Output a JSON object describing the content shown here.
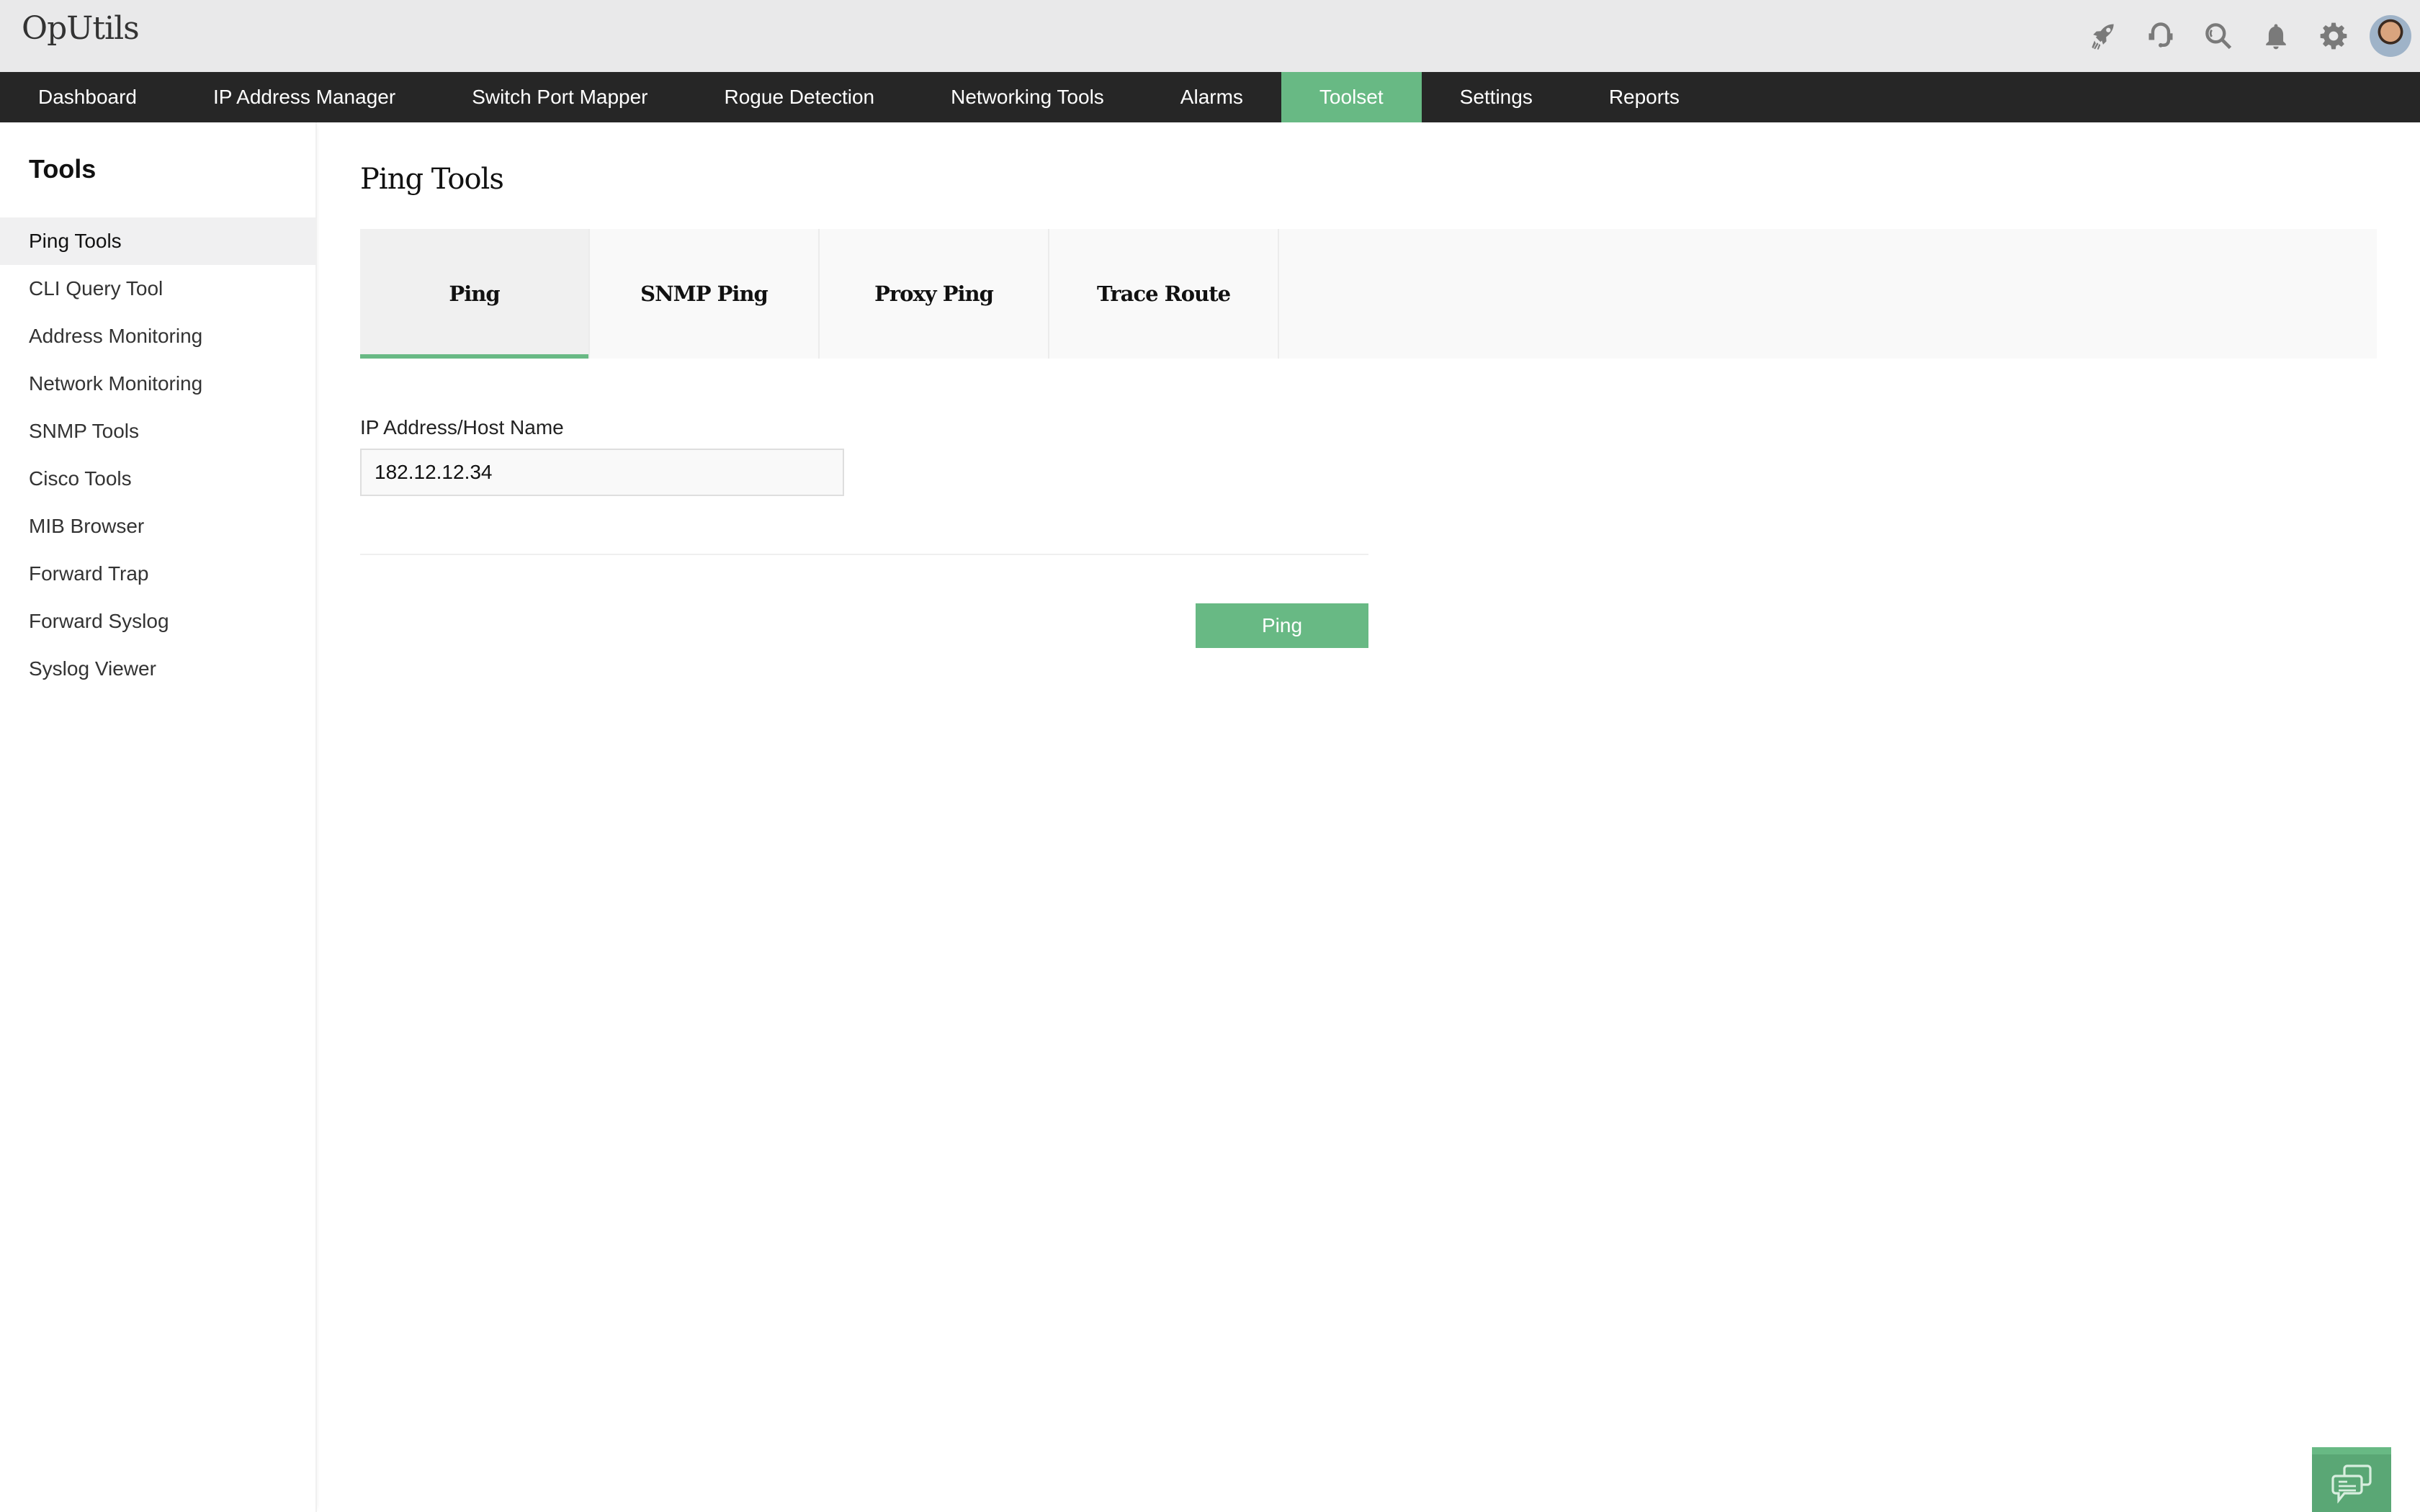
{
  "app": {
    "title": "OpUtils"
  },
  "header_icons": [
    {
      "name": "rocket-icon"
    },
    {
      "name": "headset-icon"
    },
    {
      "name": "search-icon"
    },
    {
      "name": "bell-icon"
    },
    {
      "name": "gear-icon"
    },
    {
      "name": "user-avatar"
    }
  ],
  "nav": {
    "items": [
      {
        "label": "Dashboard",
        "active": false
      },
      {
        "label": "IP Address Manager",
        "active": false
      },
      {
        "label": "Switch Port Mapper",
        "active": false
      },
      {
        "label": "Rogue Detection",
        "active": false
      },
      {
        "label": "Networking Tools",
        "active": false
      },
      {
        "label": "Alarms",
        "active": false
      },
      {
        "label": "Toolset",
        "active": true
      },
      {
        "label": "Settings",
        "active": false
      },
      {
        "label": "Reports",
        "active": false
      }
    ]
  },
  "sidebar": {
    "title": "Tools",
    "items": [
      {
        "label": "Ping Tools",
        "active": true
      },
      {
        "label": "CLI Query Tool",
        "active": false
      },
      {
        "label": "Address Monitoring",
        "active": false
      },
      {
        "label": "Network Monitoring",
        "active": false
      },
      {
        "label": "SNMP Tools",
        "active": false
      },
      {
        "label": "Cisco Tools",
        "active": false
      },
      {
        "label": "MIB Browser",
        "active": false
      },
      {
        "label": "Forward Trap",
        "active": false
      },
      {
        "label": "Forward Syslog",
        "active": false
      },
      {
        "label": "Syslog Viewer",
        "active": false
      }
    ]
  },
  "main": {
    "title": "Ping Tools",
    "tabs": [
      {
        "label": "Ping",
        "active": true
      },
      {
        "label": "SNMP Ping",
        "active": false
      },
      {
        "label": "Proxy Ping",
        "active": false
      },
      {
        "label": "Trace Route",
        "active": false
      }
    ],
    "form": {
      "host_label": "IP Address/Host Name",
      "host_value": "182.12.12.34",
      "submit_label": "Ping"
    }
  },
  "colors": {
    "accent": "#68b984",
    "navbar": "#262626",
    "header": "#e9e9ea"
  }
}
